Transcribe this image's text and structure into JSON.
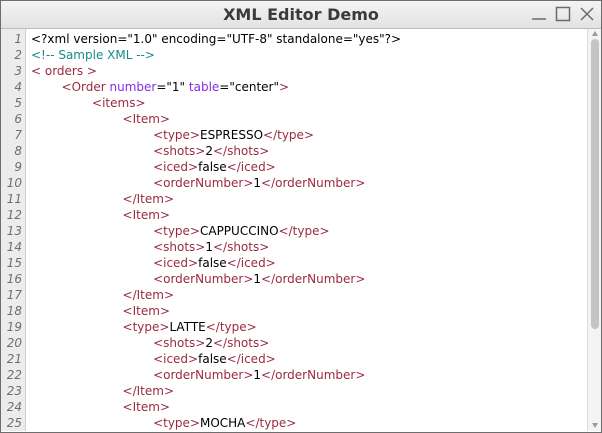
{
  "window": {
    "title": "XML Editor Demo",
    "controls": [
      "minimize-icon",
      "maximize-icon",
      "close-icon"
    ]
  },
  "editor": {
    "line_numbers": [
      "1",
      "2",
      "3",
      "4",
      "5",
      "6",
      "7",
      "8",
      "9",
      "10",
      "11",
      "12",
      "13",
      "14",
      "15",
      "16",
      "17",
      "18",
      "19",
      "20",
      "21",
      "22",
      "23",
      "24",
      "25"
    ],
    "lines": [
      [
        {
          "k": "x",
          "t": "<?xml version=\"1.0\" encoding=\"UTF-8\" standalone=\"yes\"?>"
        }
      ],
      [
        {
          "k": "c",
          "t": "<!-- Sample XML -->"
        }
      ],
      [
        {
          "k": "t",
          "t": "< orders >"
        }
      ],
      [
        {
          "k": "x",
          "t": "        "
        },
        {
          "k": "t",
          "t": "<Order "
        },
        {
          "k": "a",
          "t": "number"
        },
        {
          "k": "x",
          "t": "=\"1\" "
        },
        {
          "k": "a",
          "t": "table"
        },
        {
          "k": "x",
          "t": "=\"center\""
        },
        {
          "k": "t",
          "t": ">"
        }
      ],
      [
        {
          "k": "x",
          "t": "                "
        },
        {
          "k": "t",
          "t": "<items>"
        }
      ],
      [
        {
          "k": "x",
          "t": "                        "
        },
        {
          "k": "t",
          "t": "<Item>"
        }
      ],
      [
        {
          "k": "x",
          "t": "                                "
        },
        {
          "k": "t",
          "t": "<type>"
        },
        {
          "k": "x",
          "t": "ESPRESSO"
        },
        {
          "k": "t",
          "t": "</type>"
        }
      ],
      [
        {
          "k": "x",
          "t": "                                "
        },
        {
          "k": "t",
          "t": "<shots>"
        },
        {
          "k": "x",
          "t": "2"
        },
        {
          "k": "t",
          "t": "</shots>"
        }
      ],
      [
        {
          "k": "x",
          "t": "                                "
        },
        {
          "k": "t",
          "t": "<iced>"
        },
        {
          "k": "x",
          "t": "false"
        },
        {
          "k": "t",
          "t": "</iced>"
        }
      ],
      [
        {
          "k": "x",
          "t": "                                "
        },
        {
          "k": "t",
          "t": "<orderNumber>"
        },
        {
          "k": "x",
          "t": "1"
        },
        {
          "k": "t",
          "t": "</orderNumber>"
        }
      ],
      [
        {
          "k": "x",
          "t": "                        "
        },
        {
          "k": "t",
          "t": "</Item>"
        }
      ],
      [
        {
          "k": "x",
          "t": "                        "
        },
        {
          "k": "t",
          "t": "<Item>"
        }
      ],
      [
        {
          "k": "x",
          "t": "                                "
        },
        {
          "k": "t",
          "t": "<type>"
        },
        {
          "k": "x",
          "t": "CAPPUCCINO"
        },
        {
          "k": "t",
          "t": "</type>"
        }
      ],
      [
        {
          "k": "x",
          "t": "                                "
        },
        {
          "k": "t",
          "t": "<shots>"
        },
        {
          "k": "x",
          "t": "1"
        },
        {
          "k": "t",
          "t": "</shots>"
        }
      ],
      [
        {
          "k": "x",
          "t": "                                "
        },
        {
          "k": "t",
          "t": "<iced>"
        },
        {
          "k": "x",
          "t": "false"
        },
        {
          "k": "t",
          "t": "</iced>"
        }
      ],
      [
        {
          "k": "x",
          "t": "                                "
        },
        {
          "k": "t",
          "t": "<orderNumber>"
        },
        {
          "k": "x",
          "t": "1"
        },
        {
          "k": "t",
          "t": "</orderNumber>"
        }
      ],
      [
        {
          "k": "x",
          "t": "                        "
        },
        {
          "k": "t",
          "t": "</Item>"
        }
      ],
      [
        {
          "k": "x",
          "t": "                        "
        },
        {
          "k": "t",
          "t": "<Item>"
        }
      ],
      [
        {
          "k": "x",
          "t": "                        "
        },
        {
          "k": "t",
          "t": "<type>"
        },
        {
          "k": "x",
          "t": "LATTE"
        },
        {
          "k": "t",
          "t": "</type>"
        }
      ],
      [
        {
          "k": "x",
          "t": "                                "
        },
        {
          "k": "t",
          "t": "<shots>"
        },
        {
          "k": "x",
          "t": "2"
        },
        {
          "k": "t",
          "t": "</shots>"
        }
      ],
      [
        {
          "k": "x",
          "t": "                                "
        },
        {
          "k": "t",
          "t": "<iced>"
        },
        {
          "k": "x",
          "t": "false"
        },
        {
          "k": "t",
          "t": "</iced>"
        }
      ],
      [
        {
          "k": "x",
          "t": "                                "
        },
        {
          "k": "t",
          "t": "<orderNumber>"
        },
        {
          "k": "x",
          "t": "1"
        },
        {
          "k": "t",
          "t": "</orderNumber>"
        }
      ],
      [
        {
          "k": "x",
          "t": "                        "
        },
        {
          "k": "t",
          "t": "</Item>"
        }
      ],
      [
        {
          "k": "x",
          "t": "                        "
        },
        {
          "k": "t",
          "t": "<Item>"
        }
      ],
      [
        {
          "k": "x",
          "t": "                                "
        },
        {
          "k": "t",
          "t": "<type>"
        },
        {
          "k": "x",
          "t": "MOCHA"
        },
        {
          "k": "t",
          "t": "</type>"
        }
      ]
    ]
  },
  "colors": {
    "tag": "#9b2a44",
    "attribute": "#8a2be2",
    "comment": "#1a8a8a",
    "text": "#000000",
    "gutter_bg": "#ececec"
  }
}
